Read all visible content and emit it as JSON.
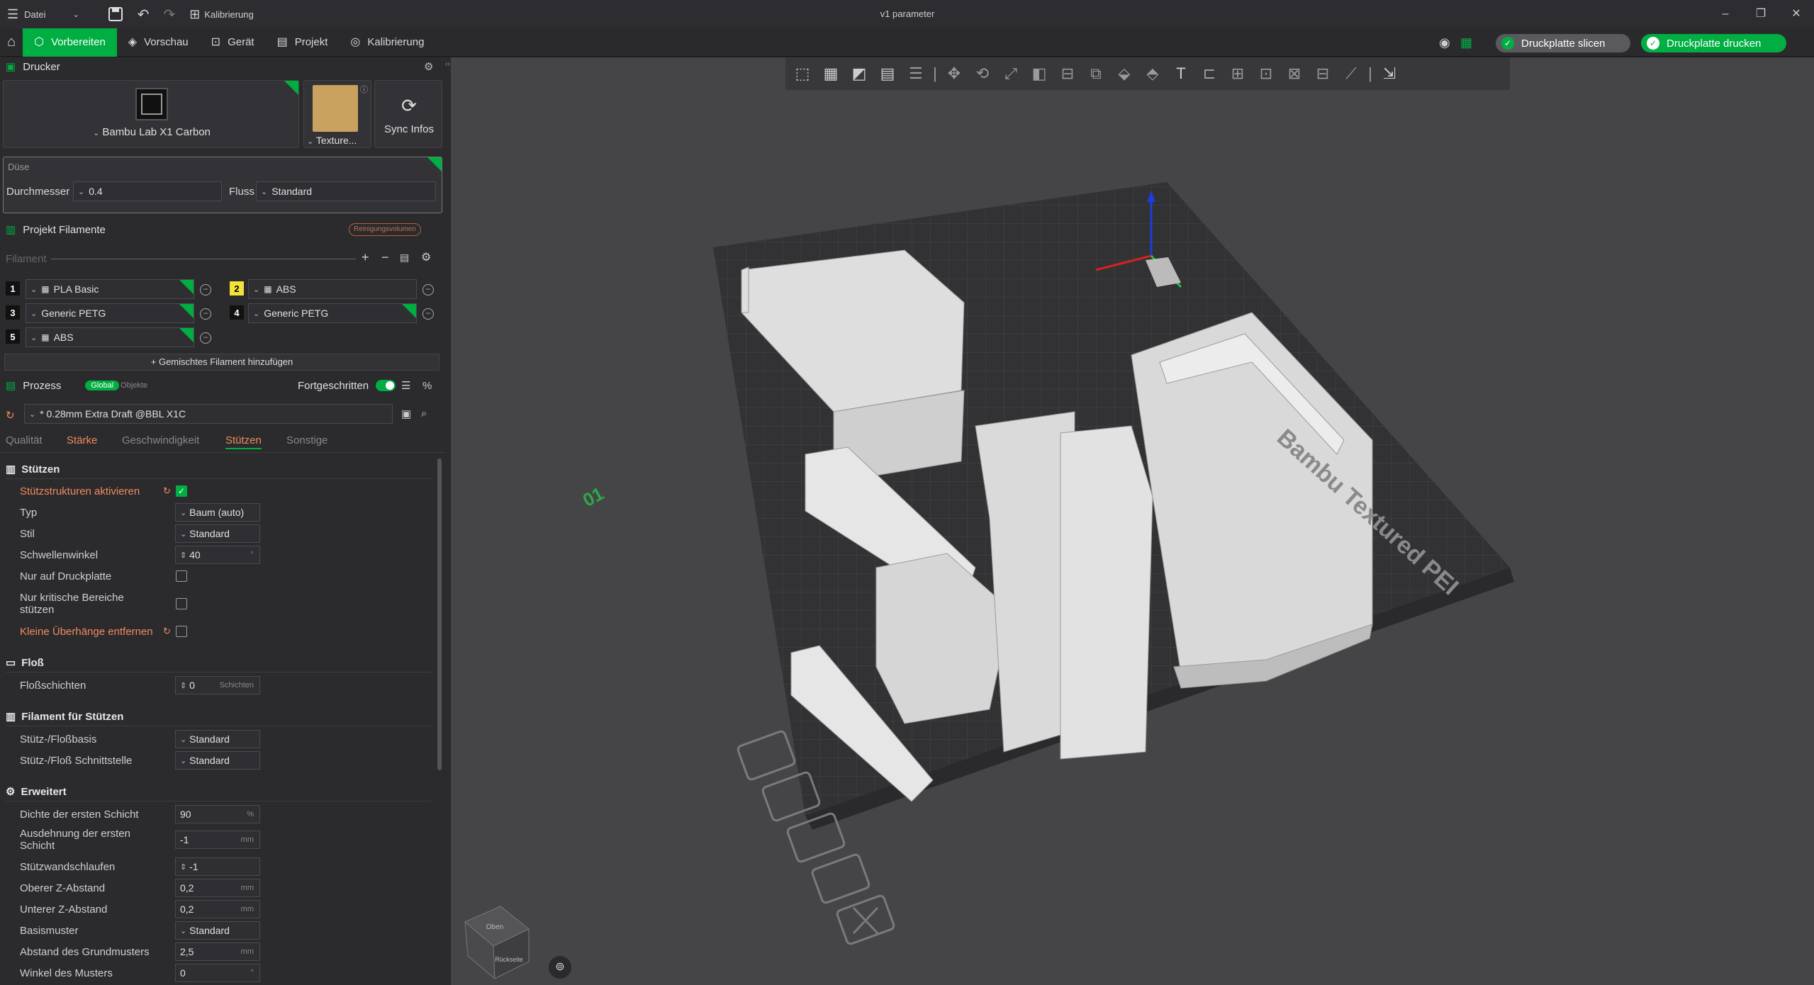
{
  "titlebar": {
    "menu_label": "Datei",
    "calib_label": "Kalibrierung",
    "window_title": "v1 parameter"
  },
  "toolbar": {
    "tabs": [
      "Vorbereiten",
      "Vorschau",
      "Gerät",
      "Projekt",
      "Kalibrierung"
    ],
    "slice_button": "Druckplatte slicen",
    "print_button": "Druckplatte drucken"
  },
  "printer": {
    "section_title": "Drucker",
    "printer_name": "Bambu Lab X1 Carbon",
    "plate_label": "Texture...",
    "sync_label": "Sync Infos",
    "nozzle_group": "Düse",
    "diameter_label": "Durchmesser",
    "diameter_value": "0.4",
    "flow_label": "Fluss",
    "flow_value": "Standard"
  },
  "filaments": {
    "section_title": "Projekt Filamente",
    "purge_button": "Reinigungsvolumen",
    "filter_label": "Filament",
    "items": [
      {
        "num": "1",
        "name": "PLA Basic",
        "color": "#111111"
      },
      {
        "num": "2",
        "name": "ABS",
        "color": "#f2e23a"
      },
      {
        "num": "3",
        "name": "Generic PETG",
        "color": "#111111"
      },
      {
        "num": "4",
        "name": "Generic PETG",
        "color": "#111111"
      },
      {
        "num": "5",
        "name": "ABS",
        "color": "#111111"
      }
    ],
    "add_mixed": "Gemischtes Filament hinzufügen"
  },
  "process": {
    "section_title": "Prozess",
    "global_label": "Global",
    "objects_label": "Objekte",
    "advanced_label": "Fortgeschritten",
    "preset": "* 0.28mm Extra Draft @BBL X1C",
    "tabs": [
      "Qualität",
      "Stärke",
      "Geschwindigkeit",
      "Stützen",
      "Sonstige"
    ]
  },
  "support": {
    "group_title": "Stützen",
    "enable_label": "Stützstrukturen aktivieren",
    "type_label": "Typ",
    "type_value": "Baum (auto)",
    "style_label": "Stil",
    "style_value": "Standard",
    "threshold_label": "Schwellenwinkel",
    "threshold_value": "40",
    "threshold_unit": "°",
    "plate_only_label": "Nur auf Druckplatte",
    "critical_label": "Nur kritische Bereiche stützen",
    "remove_small_label": "Kleine Überhänge entfernen"
  },
  "raft": {
    "group_title": "Floß",
    "layers_label": "Floßschichten",
    "layers_value": "0",
    "layers_unit": "Schichten"
  },
  "support_filament": {
    "group_title": "Filament für Stützen",
    "base_label": "Stütz-/Floßbasis",
    "base_value": "Standard",
    "interface_label": "Stütz-/Floß Schnittstelle",
    "interface_value": "Standard"
  },
  "advanced": {
    "group_title": "Erweitert",
    "rows": [
      {
        "label": "Dichte der ersten Schicht",
        "value": "90",
        "unit": "%"
      },
      {
        "label": "Ausdehnung der ersten Schicht",
        "value": "-1",
        "unit": "mm"
      },
      {
        "label": "Stützwandschlaufen",
        "value": "-1",
        "unit": ""
      },
      {
        "label": "Oberer Z-Abstand",
        "value": "0,2",
        "unit": "mm"
      },
      {
        "label": "Unterer Z-Abstand",
        "value": "0,2",
        "unit": "mm"
      },
      {
        "label": "Basismuster",
        "value": "Standard",
        "unit": ""
      },
      {
        "label": "Abstand des Grundmusters",
        "value": "2,5",
        "unit": "mm"
      },
      {
        "label": "Winkel des Musters",
        "value": "0",
        "unit": "°"
      }
    ]
  },
  "viewport": {
    "plate_brand": "Bambu Textured PEI",
    "plate_number": "01",
    "cube_top": "Oben",
    "cube_back": "Rückseite"
  },
  "colors": {
    "accent": "#00ae42",
    "modified": "#f08a5d"
  }
}
